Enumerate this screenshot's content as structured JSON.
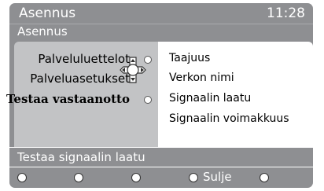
{
  "header": {
    "title": "Asennus",
    "clock": "11:28"
  },
  "subheader": {
    "title": "Asennus"
  },
  "menu": {
    "items": [
      {
        "label": "Palveluluettelot"
      },
      {
        "label": "Palveluasetukset"
      },
      {
        "label": "Testaa vastaanotto"
      }
    ],
    "active_index": 2
  },
  "submenu": {
    "items": [
      {
        "label": "Taajuus"
      },
      {
        "label": "Verkon nimi"
      },
      {
        "label": "Signaalin laatu"
      },
      {
        "label": "Signaalin voimakkuus"
      }
    ]
  },
  "status": {
    "text": "Testaa signaalin laatu"
  },
  "buttons": {
    "close_label": "Sulje"
  },
  "icons": {
    "nav": "navigation-cross-icon",
    "bullet": "bullet-icon"
  },
  "colors": {
    "panel": "#8e8f92",
    "menu_bg": "#c2c3c5",
    "submenu_bg": "#ffffff",
    "text_light": "#ffffff"
  }
}
